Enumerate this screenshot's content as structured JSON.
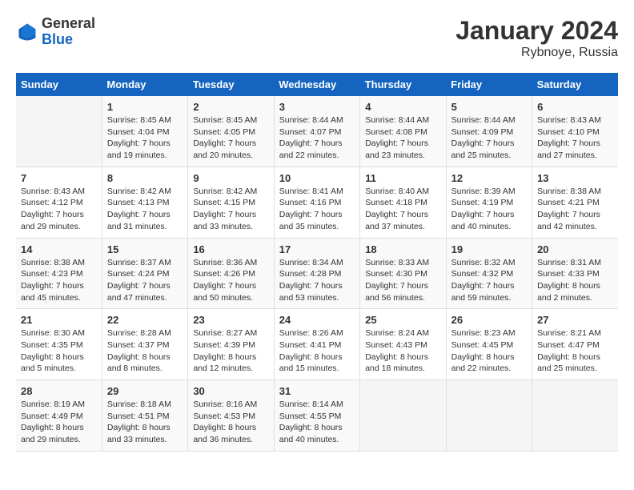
{
  "header": {
    "logo_general": "General",
    "logo_blue": "Blue",
    "title": "January 2024",
    "subtitle": "Rybnoye, Russia"
  },
  "columns": [
    "Sunday",
    "Monday",
    "Tuesday",
    "Wednesday",
    "Thursday",
    "Friday",
    "Saturday"
  ],
  "weeks": [
    [
      {
        "day": "",
        "sunrise": "",
        "sunset": "",
        "daylight": ""
      },
      {
        "day": "1",
        "sunrise": "Sunrise: 8:45 AM",
        "sunset": "Sunset: 4:04 PM",
        "daylight": "Daylight: 7 hours and 19 minutes."
      },
      {
        "day": "2",
        "sunrise": "Sunrise: 8:45 AM",
        "sunset": "Sunset: 4:05 PM",
        "daylight": "Daylight: 7 hours and 20 minutes."
      },
      {
        "day": "3",
        "sunrise": "Sunrise: 8:44 AM",
        "sunset": "Sunset: 4:07 PM",
        "daylight": "Daylight: 7 hours and 22 minutes."
      },
      {
        "day": "4",
        "sunrise": "Sunrise: 8:44 AM",
        "sunset": "Sunset: 4:08 PM",
        "daylight": "Daylight: 7 hours and 23 minutes."
      },
      {
        "day": "5",
        "sunrise": "Sunrise: 8:44 AM",
        "sunset": "Sunset: 4:09 PM",
        "daylight": "Daylight: 7 hours and 25 minutes."
      },
      {
        "day": "6",
        "sunrise": "Sunrise: 8:43 AM",
        "sunset": "Sunset: 4:10 PM",
        "daylight": "Daylight: 7 hours and 27 minutes."
      }
    ],
    [
      {
        "day": "7",
        "sunrise": "Sunrise: 8:43 AM",
        "sunset": "Sunset: 4:12 PM",
        "daylight": "Daylight: 7 hours and 29 minutes."
      },
      {
        "day": "8",
        "sunrise": "Sunrise: 8:42 AM",
        "sunset": "Sunset: 4:13 PM",
        "daylight": "Daylight: 7 hours and 31 minutes."
      },
      {
        "day": "9",
        "sunrise": "Sunrise: 8:42 AM",
        "sunset": "Sunset: 4:15 PM",
        "daylight": "Daylight: 7 hours and 33 minutes."
      },
      {
        "day": "10",
        "sunrise": "Sunrise: 8:41 AM",
        "sunset": "Sunset: 4:16 PM",
        "daylight": "Daylight: 7 hours and 35 minutes."
      },
      {
        "day": "11",
        "sunrise": "Sunrise: 8:40 AM",
        "sunset": "Sunset: 4:18 PM",
        "daylight": "Daylight: 7 hours and 37 minutes."
      },
      {
        "day": "12",
        "sunrise": "Sunrise: 8:39 AM",
        "sunset": "Sunset: 4:19 PM",
        "daylight": "Daylight: 7 hours and 40 minutes."
      },
      {
        "day": "13",
        "sunrise": "Sunrise: 8:38 AM",
        "sunset": "Sunset: 4:21 PM",
        "daylight": "Daylight: 7 hours and 42 minutes."
      }
    ],
    [
      {
        "day": "14",
        "sunrise": "Sunrise: 8:38 AM",
        "sunset": "Sunset: 4:23 PM",
        "daylight": "Daylight: 7 hours and 45 minutes."
      },
      {
        "day": "15",
        "sunrise": "Sunrise: 8:37 AM",
        "sunset": "Sunset: 4:24 PM",
        "daylight": "Daylight: 7 hours and 47 minutes."
      },
      {
        "day": "16",
        "sunrise": "Sunrise: 8:36 AM",
        "sunset": "Sunset: 4:26 PM",
        "daylight": "Daylight: 7 hours and 50 minutes."
      },
      {
        "day": "17",
        "sunrise": "Sunrise: 8:34 AM",
        "sunset": "Sunset: 4:28 PM",
        "daylight": "Daylight: 7 hours and 53 minutes."
      },
      {
        "day": "18",
        "sunrise": "Sunrise: 8:33 AM",
        "sunset": "Sunset: 4:30 PM",
        "daylight": "Daylight: 7 hours and 56 minutes."
      },
      {
        "day": "19",
        "sunrise": "Sunrise: 8:32 AM",
        "sunset": "Sunset: 4:32 PM",
        "daylight": "Daylight: 7 hours and 59 minutes."
      },
      {
        "day": "20",
        "sunrise": "Sunrise: 8:31 AM",
        "sunset": "Sunset: 4:33 PM",
        "daylight": "Daylight: 8 hours and 2 minutes."
      }
    ],
    [
      {
        "day": "21",
        "sunrise": "Sunrise: 8:30 AM",
        "sunset": "Sunset: 4:35 PM",
        "daylight": "Daylight: 8 hours and 5 minutes."
      },
      {
        "day": "22",
        "sunrise": "Sunrise: 8:28 AM",
        "sunset": "Sunset: 4:37 PM",
        "daylight": "Daylight: 8 hours and 8 minutes."
      },
      {
        "day": "23",
        "sunrise": "Sunrise: 8:27 AM",
        "sunset": "Sunset: 4:39 PM",
        "daylight": "Daylight: 8 hours and 12 minutes."
      },
      {
        "day": "24",
        "sunrise": "Sunrise: 8:26 AM",
        "sunset": "Sunset: 4:41 PM",
        "daylight": "Daylight: 8 hours and 15 minutes."
      },
      {
        "day": "25",
        "sunrise": "Sunrise: 8:24 AM",
        "sunset": "Sunset: 4:43 PM",
        "daylight": "Daylight: 8 hours and 18 minutes."
      },
      {
        "day": "26",
        "sunrise": "Sunrise: 8:23 AM",
        "sunset": "Sunset: 4:45 PM",
        "daylight": "Daylight: 8 hours and 22 minutes."
      },
      {
        "day": "27",
        "sunrise": "Sunrise: 8:21 AM",
        "sunset": "Sunset: 4:47 PM",
        "daylight": "Daylight: 8 hours and 25 minutes."
      }
    ],
    [
      {
        "day": "28",
        "sunrise": "Sunrise: 8:19 AM",
        "sunset": "Sunset: 4:49 PM",
        "daylight": "Daylight: 8 hours and 29 minutes."
      },
      {
        "day": "29",
        "sunrise": "Sunrise: 8:18 AM",
        "sunset": "Sunset: 4:51 PM",
        "daylight": "Daylight: 8 hours and 33 minutes."
      },
      {
        "day": "30",
        "sunrise": "Sunrise: 8:16 AM",
        "sunset": "Sunset: 4:53 PM",
        "daylight": "Daylight: 8 hours and 36 minutes."
      },
      {
        "day": "31",
        "sunrise": "Sunrise: 8:14 AM",
        "sunset": "Sunset: 4:55 PM",
        "daylight": "Daylight: 8 hours and 40 minutes."
      },
      {
        "day": "",
        "sunrise": "",
        "sunset": "",
        "daylight": ""
      },
      {
        "day": "",
        "sunrise": "",
        "sunset": "",
        "daylight": ""
      },
      {
        "day": "",
        "sunrise": "",
        "sunset": "",
        "daylight": ""
      }
    ]
  ]
}
